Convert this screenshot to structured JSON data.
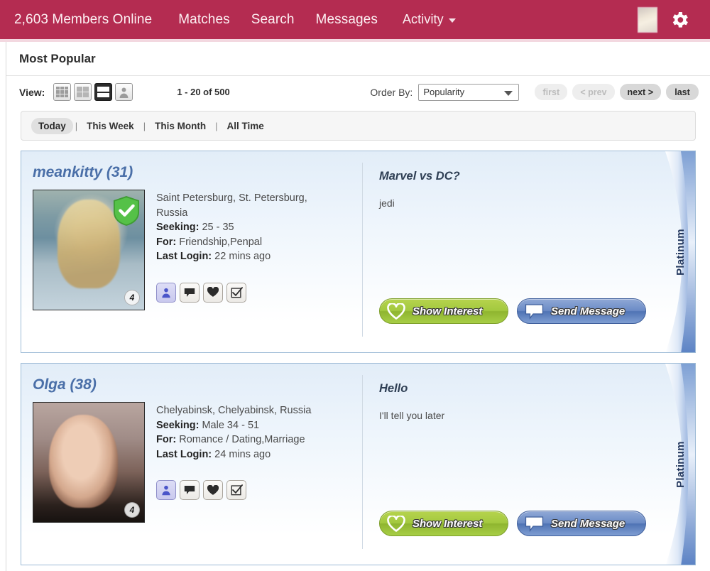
{
  "nav": {
    "members_online": "2,603 Members Online",
    "items": [
      {
        "label": "Matches"
      },
      {
        "label": "Search"
      },
      {
        "label": "Messages"
      }
    ],
    "activity": "Activity",
    "avatar_name": "user-avatar",
    "settings_name": "settings-gear"
  },
  "header": {
    "title": "Most Popular"
  },
  "toolbar": {
    "view_label": "View:",
    "view_options": [
      {
        "name": "grid-large-view",
        "selected": false
      },
      {
        "name": "grid-small-view",
        "selected": false
      },
      {
        "name": "list-view",
        "selected": true
      },
      {
        "name": "gallery-view",
        "selected": false
      }
    ],
    "result_count": "1 - 20 of 500",
    "orderby_label": "Order By:",
    "orderby_value": "Popularity",
    "orderby_options": [
      "Popularity"
    ],
    "pager": [
      {
        "label": "first",
        "enabled": false
      },
      {
        "label": "< prev",
        "enabled": false
      },
      {
        "label": "next >",
        "enabled": true
      },
      {
        "label": "last",
        "enabled": true
      }
    ]
  },
  "filters": {
    "tabs": [
      {
        "label": "Today",
        "active": true
      },
      {
        "label": "This Week",
        "active": false
      },
      {
        "label": "This Month",
        "active": false
      },
      {
        "label": "All Time",
        "active": false
      }
    ],
    "separator": "|"
  },
  "labels": {
    "seeking": "Seeking:",
    "for": "For:",
    "last_login": "Last Login:",
    "show_interest": "Show Interest",
    "send_message": "Send Message",
    "badge_platinum": "Platinum"
  },
  "colors": {
    "nav_bg": "#b42c51",
    "card_border": "#9dbbd6",
    "username": "#4a6fa8",
    "cta_green": "#a3c93f",
    "cta_blue": "#6c8cc6",
    "verified_shield": "#55c148",
    "ribbon_blue": "#5b82c4"
  },
  "profiles": [
    {
      "username": "meankitty (31)",
      "location": "Saint Petersburg, St. Petersburg, Russia",
      "seeking": "25 - 35",
      "for": "Friendship,Penpal",
      "last_login": "22 mins ago",
      "photo_count": "4",
      "verified": true,
      "membership": "Platinum",
      "question": "Marvel vs DC?",
      "answer": "jedi",
      "actions": [
        {
          "name": "view-profile-icon",
          "selected": true
        },
        {
          "name": "chat-bubble-icon",
          "selected": false
        },
        {
          "name": "favorite-heart-icon",
          "selected": false
        },
        {
          "name": "checklist-icon",
          "selected": false
        }
      ]
    },
    {
      "username": "Olga (38)",
      "location": "Chelyabinsk, Chelyabinsk, Russia",
      "seeking": "Male 34 - 51",
      "for": "Romance / Dating,Marriage",
      "last_login": "24 mins ago",
      "photo_count": "4",
      "verified": false,
      "membership": "Platinum",
      "question": "Hello",
      "answer": "I'll tell you later",
      "actions": [
        {
          "name": "view-profile-icon",
          "selected": true
        },
        {
          "name": "chat-bubble-icon",
          "selected": false
        },
        {
          "name": "favorite-heart-icon",
          "selected": false
        },
        {
          "name": "checklist-icon",
          "selected": false
        }
      ]
    }
  ]
}
